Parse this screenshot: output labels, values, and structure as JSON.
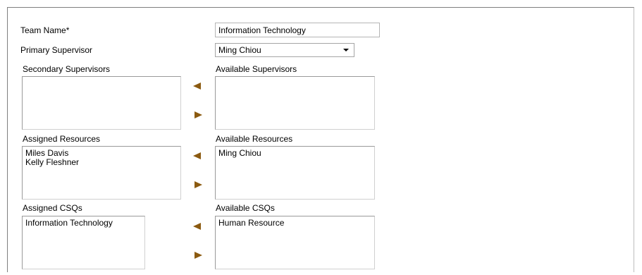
{
  "form": {
    "team_name_label": "Team Name*",
    "team_name_value": "Information Technology",
    "primary_supervisor_label": "Primary Supervisor",
    "primary_supervisor_value": "Ming Chiou",
    "secondary_supervisors_label": "Secondary Supervisors",
    "available_supervisors_label": "Available Supervisors",
    "assigned_resources_label": "Assigned Resources",
    "available_resources_label": "Available Resources",
    "assigned_csqs_label": "Assigned CSQs",
    "available_csqs_label": "Available CSQs"
  },
  "lists": {
    "secondary_supervisors": [],
    "available_supervisors": [],
    "assigned_resources": [
      "Miles Davis",
      "Kelly Fleshner"
    ],
    "available_resources": [
      "Ming Chiou"
    ],
    "assigned_csqs": [
      "Information Technology"
    ],
    "available_csqs": [
      "Human Resource"
    ]
  },
  "icons": {
    "move_left": "left-arrow-icon",
    "move_right": "right-arrow-icon"
  },
  "colors": {
    "arrow": "#8b5a10"
  }
}
